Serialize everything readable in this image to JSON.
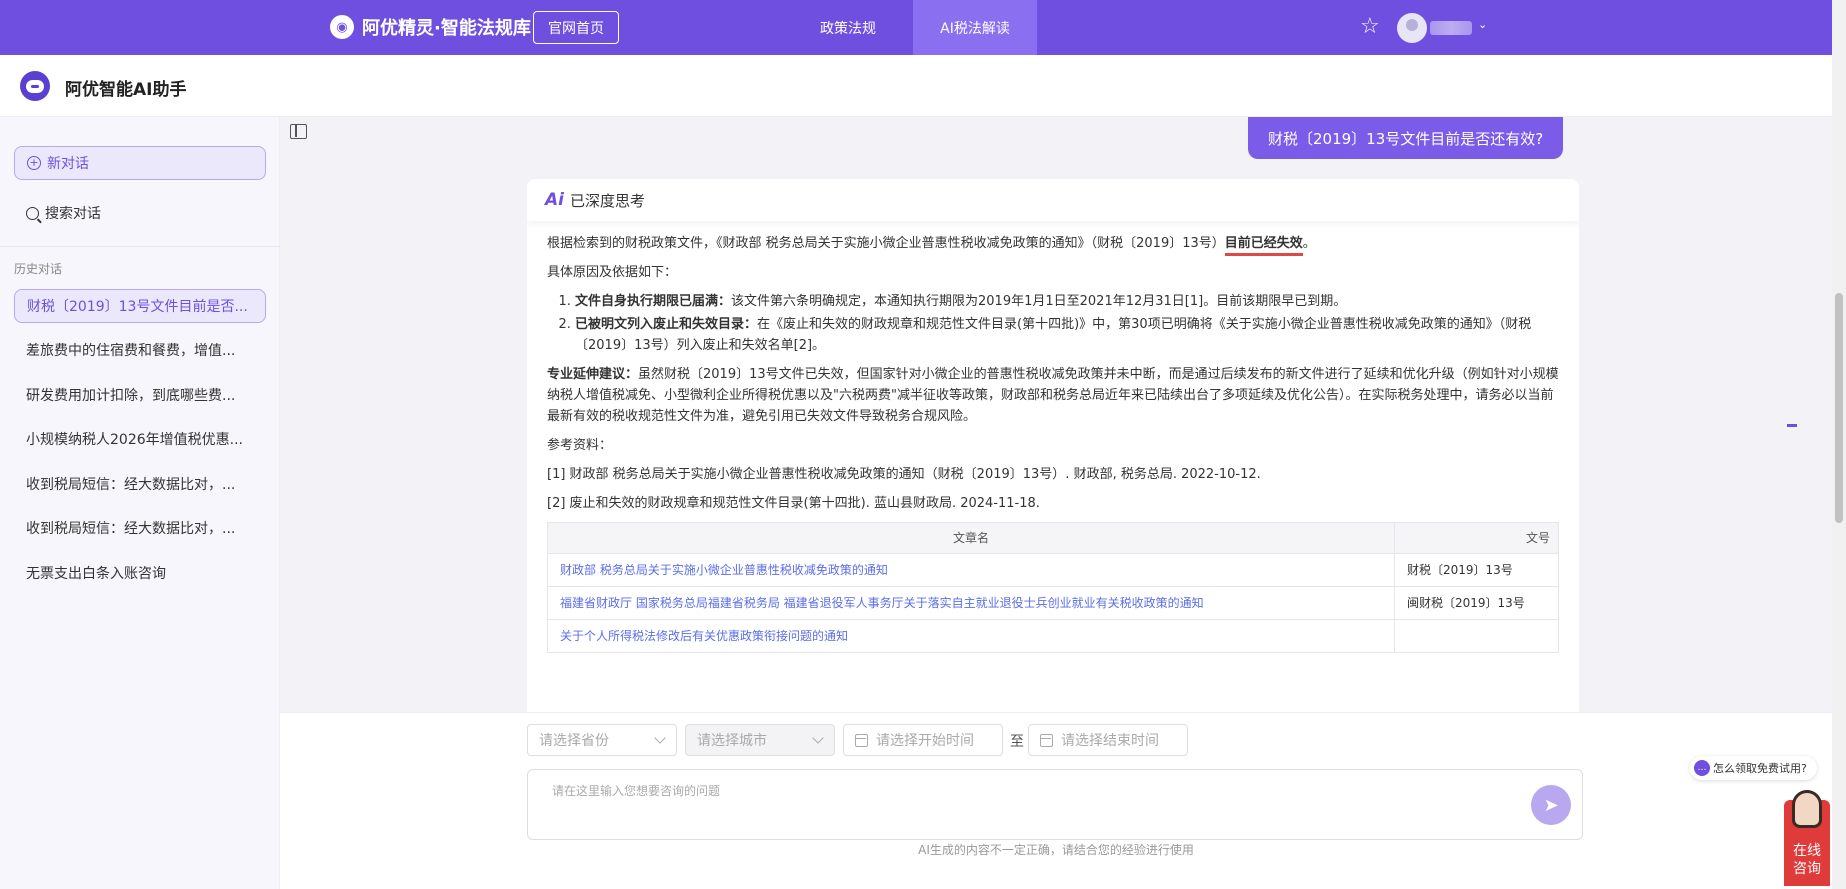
{
  "topnav": {
    "brand": "阿优精灵·智能法规库",
    "home_button": "官网首页",
    "tabs": [
      {
        "label": "政策法规",
        "active": false
      },
      {
        "label": "AI税法解读",
        "active": true
      }
    ],
    "accent_color": "#6f4fe0"
  },
  "assistant": {
    "title": "阿优智能AI助手"
  },
  "sidebar": {
    "new_chat": "新对话",
    "search_chat": "搜索对话",
    "history_label": "历史对话",
    "history": [
      {
        "label": "财税〔2019〕13号文件目前是否...",
        "active": true
      },
      {
        "label": "差旅费中的住宿费和餐费，增值...",
        "active": false
      },
      {
        "label": "研发费用加计扣除，到底哪些费...",
        "active": false
      },
      {
        "label": "小规模纳税人2026年增值税优惠...",
        "active": false
      },
      {
        "label": "收到税局短信：经大数据比对，...",
        "active": false
      },
      {
        "label": "收到税局短信：经大数据比对，...",
        "active": false
      },
      {
        "label": "无票支出白条入账咨询",
        "active": false
      }
    ]
  },
  "chat": {
    "user_message": "财税〔2019〕13号文件目前是否还有效?",
    "think_label": "已深度思考",
    "ai_logo": "Ai",
    "intro_pre": "根据检索到的财税政策文件，《财政部 税务总局关于实施小微企业普惠性税收减免政策的通知》（财税〔2019〕13号）",
    "intro_bold": "目前已经失效",
    "intro_post": "。",
    "reasons_label": "具体原因及依据如下：",
    "reasons": [
      {
        "bold": "文件自身执行期限已届满：",
        "text": "该文件第六条明确规定，本通知执行期限为2019年1月1日至2021年12月31日[1]。目前该期限早已到期。"
      },
      {
        "bold": "已被明文列入废止和失效目录：",
        "text": "在《废止和失效的财政规章和规范性文件目录(第十四批)》中，第30项已明确将《关于实施小微企业普惠性税收减免政策的通知》（财税〔2019〕13号）列入废止和失效名单[2]。"
      }
    ],
    "advice_bold": "专业延伸建议：",
    "advice_text": "虽然财税〔2019〕13号文件已失效，但国家针对小微企业的普惠性税收减免政策并未中断，而是通过后续发布的新文件进行了延续和优化升级（例如针对小规模纳税人增值税减免、小型微利企业所得税优惠以及\"六税两费\"减半征收等政策，财政部和税务总局近年来已陆续出台了多项延续及优化公告）。在实际税务处理中，请务必以当前最新有效的税收规范性文件为准，避免引用已失效文件导致税务合规风险。",
    "refs_label": "参考资料：",
    "refs": [
      "[1] 财政部 税务总局关于实施小微企业普惠性税收减免政策的通知（财税〔2019〕13号）. 财政部, 税务总局. 2022-10-12.",
      "[2] 废止和失效的财政规章和规范性文件目录(第十四批). 蓝山县财政局. 2024-11-18."
    ],
    "table": {
      "headers": [
        "文章名",
        "文号"
      ],
      "rows": [
        [
          "财政部 税务总局关于实施小微企业普惠性税收减免政策的通知",
          "财税〔2019〕13号"
        ],
        [
          "福建省财政厅 国家税务总局福建省税务局 福建省退役军人事务厅关于落实自主就业退役士兵创业就业有关税收政策的通知",
          "闽财税〔2019〕13号"
        ],
        [
          "关于个人所得税法修改后有关优惠政策衔接问题的通知",
          ""
        ]
      ]
    }
  },
  "input": {
    "province_placeholder": "请选择省份",
    "city_placeholder": "请选择城市",
    "start_placeholder": "请选择开始时间",
    "to_label": "至",
    "end_placeholder": "请选择结束时间",
    "question_placeholder": "请在这里输入您想要咨询的问题",
    "footnote": "AI生成的内容不一定正确，请结合您的经验进行使用"
  },
  "widgets": {
    "free_trial": "怎么领取免费试用?",
    "online_line1": "在线",
    "online_line2": "咨询"
  }
}
